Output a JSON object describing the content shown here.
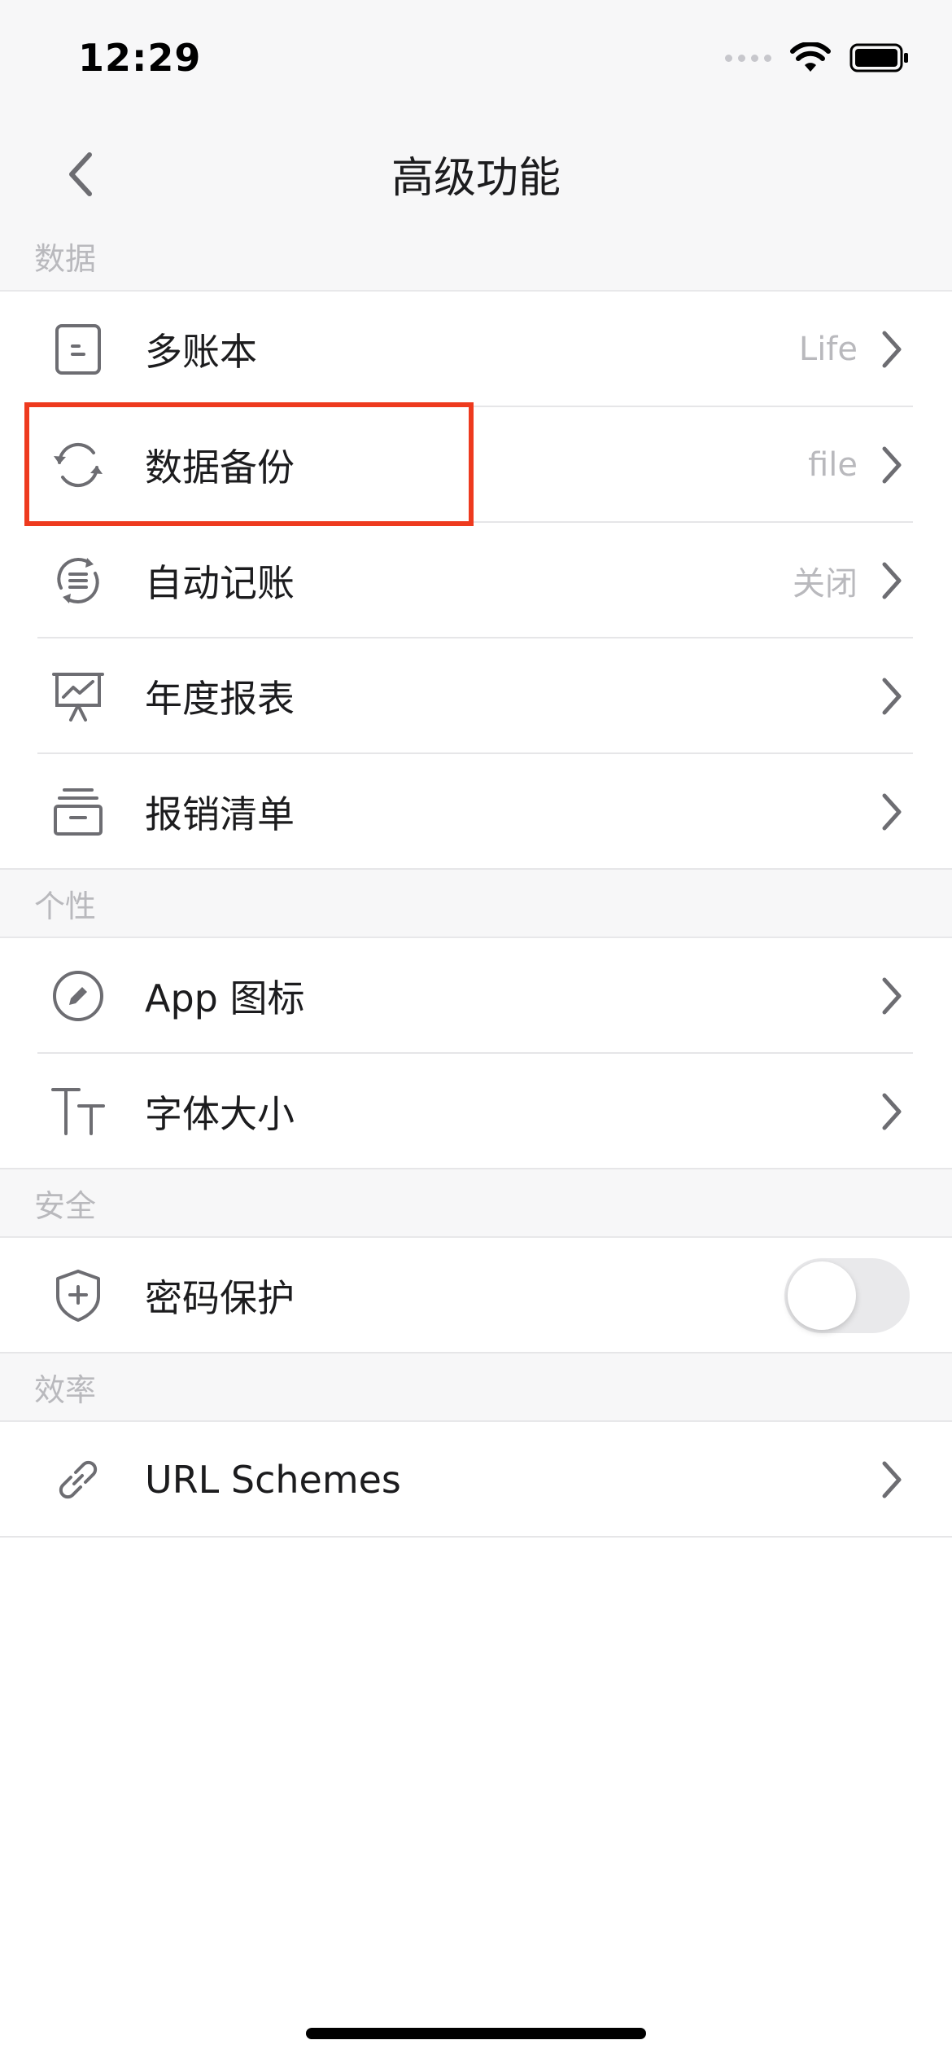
{
  "status_bar": {
    "time": "12:29"
  },
  "nav": {
    "title": "高级功能"
  },
  "sections": {
    "data": {
      "header": "数据",
      "rows": [
        {
          "label": "多账本",
          "value": "Life"
        },
        {
          "label": "数据备份",
          "value": "file"
        },
        {
          "label": "自动记账",
          "value": "关闭"
        },
        {
          "label": "年度报表",
          "value": ""
        },
        {
          "label": "报销清单",
          "value": ""
        }
      ]
    },
    "personal": {
      "header": "个性",
      "rows": [
        {
          "label": "App 图标"
        },
        {
          "label": "字体大小"
        }
      ]
    },
    "security": {
      "header": "安全",
      "rows": [
        {
          "label": "密码保护",
          "toggle_on": false
        }
      ]
    },
    "efficiency": {
      "header": "效率",
      "rows": [
        {
          "label": "URL Schemes"
        }
      ]
    }
  },
  "colors": {
    "highlight": "#ee3a1e",
    "icon": "#6d6d72",
    "secondary_text": "#b9b9bd"
  }
}
